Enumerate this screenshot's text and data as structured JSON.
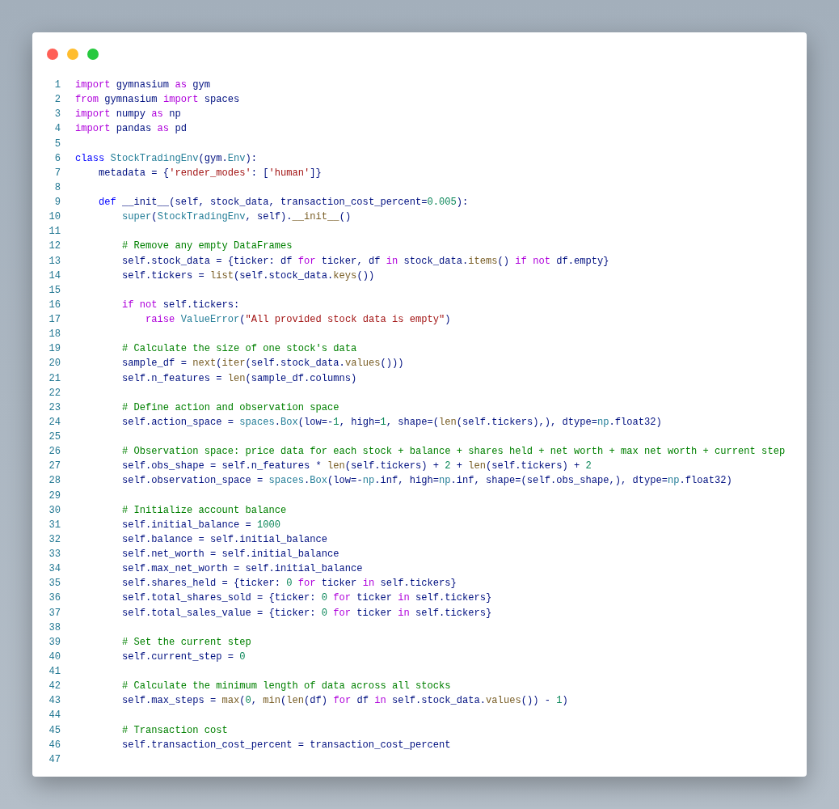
{
  "window": {
    "controls": [
      {
        "kind": "close"
      },
      {
        "kind": "minimize"
      },
      {
        "kind": "zoom"
      }
    ]
  },
  "code": [
    {
      "number": "1",
      "tokens": [
        {
          "kind": "kw",
          "text": "import"
        },
        {
          "kind": "var",
          "text": " gymnasium "
        },
        {
          "kind": "kw",
          "text": "as"
        },
        {
          "kind": "var",
          "text": " gym"
        }
      ]
    },
    {
      "number": "2",
      "tokens": [
        {
          "kind": "kw",
          "text": "from"
        },
        {
          "kind": "var",
          "text": " gymnasium "
        },
        {
          "kind": "kw",
          "text": "import"
        },
        {
          "kind": "var",
          "text": " spaces"
        }
      ]
    },
    {
      "number": "3",
      "tokens": [
        {
          "kind": "kw",
          "text": "import"
        },
        {
          "kind": "var",
          "text": " numpy "
        },
        {
          "kind": "kw",
          "text": "as"
        },
        {
          "kind": "var",
          "text": " np"
        }
      ]
    },
    {
      "number": "4",
      "tokens": [
        {
          "kind": "kw",
          "text": "import"
        },
        {
          "kind": "var",
          "text": " pandas "
        },
        {
          "kind": "kw",
          "text": "as"
        },
        {
          "kind": "var",
          "text": " pd"
        }
      ]
    },
    {
      "number": "5"
    },
    {
      "number": "6",
      "tokens": [
        {
          "kind": "st",
          "text": "class"
        },
        {
          "kind": "ty",
          "text": " StockTradingEnv"
        },
        {
          "kind": "var",
          "text": "(gym."
        },
        {
          "kind": "ty",
          "text": "Env"
        },
        {
          "kind": "var",
          "text": "):"
        }
      ]
    },
    {
      "number": "7",
      "tokens": [
        {
          "kind": "var",
          "text": "    metadata = {"
        },
        {
          "kind": "str",
          "text": "'render_modes'"
        },
        {
          "kind": "var",
          "text": ": ["
        },
        {
          "kind": "str",
          "text": "'human'"
        },
        {
          "kind": "var",
          "text": "]}"
        }
      ]
    },
    {
      "number": "8"
    },
    {
      "number": "9",
      "tokens": [
        {
          "kind": "st",
          "text": "    def"
        },
        {
          "kind": "var",
          "text": " __init__(self, stock_data, transaction_cost_percent="
        },
        {
          "kind": "num",
          "text": "0.005"
        },
        {
          "kind": "var",
          "text": "):"
        }
      ]
    },
    {
      "number": "10",
      "tokens": [
        {
          "kind": "ty",
          "text": "        super"
        },
        {
          "kind": "var",
          "text": "("
        },
        {
          "kind": "ty",
          "text": "StockTradingEnv"
        },
        {
          "kind": "var",
          "text": ", self)."
        },
        {
          "kind": "fn",
          "text": "__init__"
        },
        {
          "kind": "var",
          "text": "()"
        }
      ]
    },
    {
      "number": "11"
    },
    {
      "number": "12",
      "tokens": [
        {
          "kind": "com",
          "text": "        # Remove any empty DataFrames"
        }
      ]
    },
    {
      "number": "13",
      "tokens": [
        {
          "kind": "var",
          "text": "        self.stock_data = {ticker: df "
        },
        {
          "kind": "kw",
          "text": "for"
        },
        {
          "kind": "var",
          "text": " ticker, df "
        },
        {
          "kind": "kw",
          "text": "in"
        },
        {
          "kind": "var",
          "text": " stock_data."
        },
        {
          "kind": "fn",
          "text": "items"
        },
        {
          "kind": "var",
          "text": "() "
        },
        {
          "kind": "kw",
          "text": "if"
        },
        {
          "kind": "kw",
          "text": " not"
        },
        {
          "kind": "var",
          "text": " df.empty}"
        }
      ]
    },
    {
      "number": "14",
      "tokens": [
        {
          "kind": "var",
          "text": "        self.tickers = "
        },
        {
          "kind": "fn",
          "text": "list"
        },
        {
          "kind": "var",
          "text": "(self.stock_data."
        },
        {
          "kind": "fn",
          "text": "keys"
        },
        {
          "kind": "var",
          "text": "())"
        }
      ]
    },
    {
      "number": "15"
    },
    {
      "number": "16",
      "tokens": [
        {
          "kind": "kw",
          "text": "        if"
        },
        {
          "kind": "kw",
          "text": " not"
        },
        {
          "kind": "var",
          "text": " self.tickers:"
        }
      ]
    },
    {
      "number": "17",
      "tokens": [
        {
          "kind": "kw",
          "text": "            raise"
        },
        {
          "kind": "ty",
          "text": " ValueError"
        },
        {
          "kind": "var",
          "text": "("
        },
        {
          "kind": "str",
          "text": "\"All provided stock data is empty\""
        },
        {
          "kind": "var",
          "text": ")"
        }
      ]
    },
    {
      "number": "18"
    },
    {
      "number": "19",
      "tokens": [
        {
          "kind": "com",
          "text": "        # Calculate the size of one stock's data"
        }
      ]
    },
    {
      "number": "20",
      "tokens": [
        {
          "kind": "var",
          "text": "        sample_df = "
        },
        {
          "kind": "fn",
          "text": "next"
        },
        {
          "kind": "var",
          "text": "("
        },
        {
          "kind": "fn",
          "text": "iter"
        },
        {
          "kind": "var",
          "text": "(self.stock_data."
        },
        {
          "kind": "fn",
          "text": "values"
        },
        {
          "kind": "var",
          "text": "()))"
        }
      ]
    },
    {
      "number": "21",
      "tokens": [
        {
          "kind": "var",
          "text": "        self.n_features = "
        },
        {
          "kind": "fn",
          "text": "len"
        },
        {
          "kind": "var",
          "text": "(sample_df.columns)"
        }
      ]
    },
    {
      "number": "22"
    },
    {
      "number": "23",
      "tokens": [
        {
          "kind": "com",
          "text": "        # Define action and observation space"
        }
      ]
    },
    {
      "number": "24",
      "tokens": [
        {
          "kind": "var",
          "text": "        self.action_space = "
        },
        {
          "kind": "ty",
          "text": "spaces"
        },
        {
          "kind": "var",
          "text": "."
        },
        {
          "kind": "ty",
          "text": "Box"
        },
        {
          "kind": "var",
          "text": "(low=-"
        },
        {
          "kind": "num",
          "text": "1"
        },
        {
          "kind": "var",
          "text": ", high="
        },
        {
          "kind": "num",
          "text": "1"
        },
        {
          "kind": "var",
          "text": ", shape=("
        },
        {
          "kind": "fn",
          "text": "len"
        },
        {
          "kind": "var",
          "text": "(self.tickers),), dtype="
        },
        {
          "kind": "ty",
          "text": "np"
        },
        {
          "kind": "var",
          "text": ".float32)"
        }
      ]
    },
    {
      "number": "25"
    },
    {
      "number": "26",
      "tokens": [
        {
          "kind": "com",
          "text": "        # Observation space: price data for each stock + balance + shares held + net worth + max net worth + current step"
        }
      ]
    },
    {
      "number": "27",
      "tokens": [
        {
          "kind": "var",
          "text": "        self.obs_shape = self.n_features * "
        },
        {
          "kind": "fn",
          "text": "len"
        },
        {
          "kind": "var",
          "text": "(self.tickers) + "
        },
        {
          "kind": "num",
          "text": "2"
        },
        {
          "kind": "var",
          "text": " + "
        },
        {
          "kind": "fn",
          "text": "len"
        },
        {
          "kind": "var",
          "text": "(self.tickers) + "
        },
        {
          "kind": "num",
          "text": "2"
        }
      ]
    },
    {
      "number": "28",
      "tokens": [
        {
          "kind": "var",
          "text": "        self.observation_space = "
        },
        {
          "kind": "ty",
          "text": "spaces"
        },
        {
          "kind": "var",
          "text": "."
        },
        {
          "kind": "ty",
          "text": "Box"
        },
        {
          "kind": "var",
          "text": "(low=-"
        },
        {
          "kind": "ty",
          "text": "np"
        },
        {
          "kind": "var",
          "text": ".inf, high="
        },
        {
          "kind": "ty",
          "text": "np"
        },
        {
          "kind": "var",
          "text": ".inf, shape=(self.obs_shape,), dtype="
        },
        {
          "kind": "ty",
          "text": "np"
        },
        {
          "kind": "var",
          "text": ".float32)"
        }
      ]
    },
    {
      "number": "29"
    },
    {
      "number": "30",
      "tokens": [
        {
          "kind": "com",
          "text": "        # Initialize account balance"
        }
      ]
    },
    {
      "number": "31",
      "tokens": [
        {
          "kind": "var",
          "text": "        self.initial_balance = "
        },
        {
          "kind": "num",
          "text": "1000"
        }
      ]
    },
    {
      "number": "32",
      "tokens": [
        {
          "kind": "var",
          "text": "        self.balance = self.initial_balance"
        }
      ]
    },
    {
      "number": "33",
      "tokens": [
        {
          "kind": "var",
          "text": "        self.net_worth = self.initial_balance"
        }
      ]
    },
    {
      "number": "34",
      "tokens": [
        {
          "kind": "var",
          "text": "        self.max_net_worth = self.initial_balance"
        }
      ]
    },
    {
      "number": "35",
      "tokens": [
        {
          "kind": "var",
          "text": "        self.shares_held = {ticker: "
        },
        {
          "kind": "num",
          "text": "0"
        },
        {
          "kind": "kw",
          "text": " for"
        },
        {
          "kind": "var",
          "text": " ticker "
        },
        {
          "kind": "kw",
          "text": "in"
        },
        {
          "kind": "var",
          "text": " self.tickers}"
        }
      ]
    },
    {
      "number": "36",
      "tokens": [
        {
          "kind": "var",
          "text": "        self.total_shares_sold = {ticker: "
        },
        {
          "kind": "num",
          "text": "0"
        },
        {
          "kind": "kw",
          "text": " for"
        },
        {
          "kind": "var",
          "text": " ticker "
        },
        {
          "kind": "kw",
          "text": "in"
        },
        {
          "kind": "var",
          "text": " self.tickers}"
        }
      ]
    },
    {
      "number": "37",
      "tokens": [
        {
          "kind": "var",
          "text": "        self.total_sales_value = {ticker: "
        },
        {
          "kind": "num",
          "text": "0"
        },
        {
          "kind": "kw",
          "text": " for"
        },
        {
          "kind": "var",
          "text": " ticker "
        },
        {
          "kind": "kw",
          "text": "in"
        },
        {
          "kind": "var",
          "text": " self.tickers}"
        }
      ]
    },
    {
      "number": "38"
    },
    {
      "number": "39",
      "tokens": [
        {
          "kind": "com",
          "text": "        # Set the current step"
        }
      ]
    },
    {
      "number": "40",
      "tokens": [
        {
          "kind": "var",
          "text": "        self.current_step = "
        },
        {
          "kind": "num",
          "text": "0"
        }
      ]
    },
    {
      "number": "41"
    },
    {
      "number": "42",
      "tokens": [
        {
          "kind": "com",
          "text": "        # Calculate the minimum length of data across all stocks"
        }
      ]
    },
    {
      "number": "43",
      "tokens": [
        {
          "kind": "var",
          "text": "        self.max_steps = "
        },
        {
          "kind": "fn",
          "text": "max"
        },
        {
          "kind": "var",
          "text": "("
        },
        {
          "kind": "num",
          "text": "0"
        },
        {
          "kind": "var",
          "text": ", "
        },
        {
          "kind": "fn",
          "text": "min"
        },
        {
          "kind": "var",
          "text": "("
        },
        {
          "kind": "fn",
          "text": "len"
        },
        {
          "kind": "var",
          "text": "(df) "
        },
        {
          "kind": "kw",
          "text": "for"
        },
        {
          "kind": "var",
          "text": " df "
        },
        {
          "kind": "kw",
          "text": "in"
        },
        {
          "kind": "var",
          "text": " self.stock_data."
        },
        {
          "kind": "fn",
          "text": "values"
        },
        {
          "kind": "var",
          "text": "()) - "
        },
        {
          "kind": "num",
          "text": "1"
        },
        {
          "kind": "var",
          "text": ")"
        }
      ]
    },
    {
      "number": "44"
    },
    {
      "number": "45",
      "tokens": [
        {
          "kind": "com",
          "text": "        # Transaction cost"
        }
      ]
    },
    {
      "number": "46",
      "tokens": [
        {
          "kind": "var",
          "text": "        self.transaction_cost_percent = transaction_cost_percent"
        }
      ]
    },
    {
      "number": "47"
    }
  ]
}
